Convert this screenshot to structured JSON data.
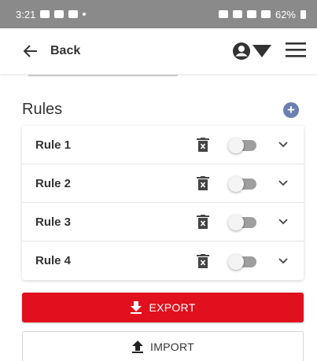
{
  "status_bar": {
    "time": "3:21",
    "battery": "62%"
  },
  "app_bar": {
    "back_label": "Back"
  },
  "section": {
    "title": "Rules"
  },
  "rules": [
    {
      "name": "Rule 1",
      "enabled": false
    },
    {
      "name": "Rule 2",
      "enabled": false
    },
    {
      "name": "Rule 3",
      "enabled": false
    },
    {
      "name": "Rule 4",
      "enabled": false
    }
  ],
  "actions": {
    "export_label": "EXPORT",
    "import_label": "IMPORT"
  },
  "colors": {
    "export_bg": "#e0101e",
    "add_button": "#6b7fb0",
    "status_bar_bg": "#8a8a8a"
  },
  "icons": [
    "back-arrow-icon",
    "account-icon",
    "menu-icon",
    "add-icon",
    "trash-icon",
    "chevron-down-icon",
    "download-icon",
    "upload-icon"
  ]
}
